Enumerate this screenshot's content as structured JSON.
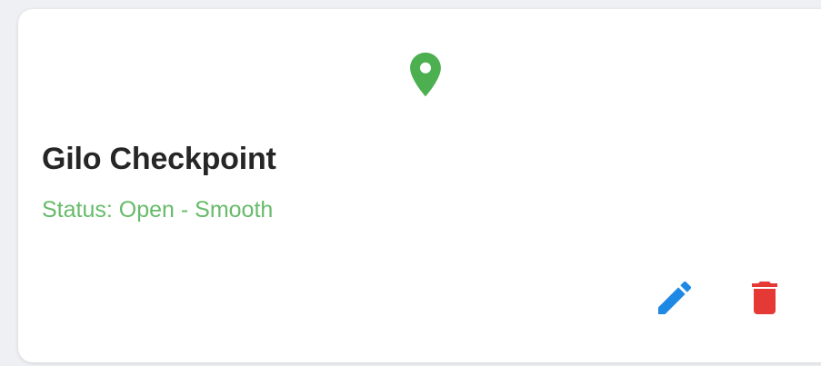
{
  "card": {
    "title": "Gilo Checkpoint",
    "status": "Status: Open - Smooth"
  },
  "icons": {
    "pin": "location-pin-icon",
    "edit": "pencil-icon",
    "delete": "trash-icon"
  },
  "colors": {
    "pin": "#4caf50",
    "status_text": "#66bb6a",
    "edit": "#1e88e5",
    "delete": "#e53935"
  }
}
